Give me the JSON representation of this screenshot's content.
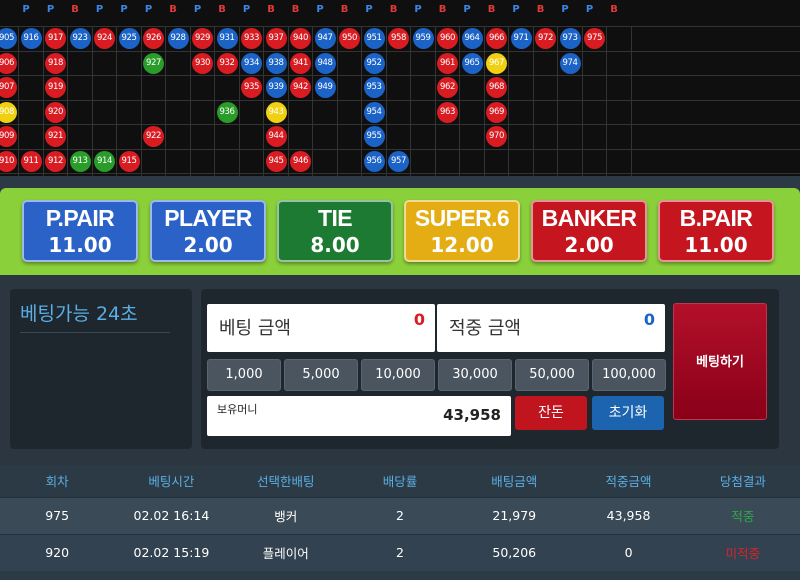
{
  "colors": {
    "player": "#1c63c8",
    "banker": "#d81c22",
    "tie": "#2a9c2a",
    "super6": "#f0d010"
  },
  "road": {
    "header": [
      "P",
      "P",
      "B",
      "P",
      "P",
      "P",
      "B",
      "P",
      "B",
      "P",
      "B",
      "B",
      "P",
      "B",
      "P",
      "B",
      "P",
      "B",
      "P",
      "B",
      "P",
      "B",
      "P",
      "P",
      "B"
    ],
    "header_first_index": 0,
    "columns": [
      {
        "beads": [
          [
            "905",
            "P"
          ],
          [
            "906",
            "B"
          ],
          [
            "907",
            "B"
          ],
          [
            "908",
            "S"
          ],
          [
            "909",
            "B"
          ],
          [
            "910",
            "B"
          ]
        ]
      },
      {
        "beads": [
          [
            "916",
            "P"
          ],
          null,
          null,
          null,
          null,
          [
            "911",
            "B"
          ]
        ]
      },
      {
        "beads": [
          [
            "917",
            "B"
          ],
          [
            "918",
            "B"
          ],
          [
            "919",
            "B"
          ],
          [
            "920",
            "B"
          ],
          [
            "921",
            "B"
          ],
          [
            "912",
            "B"
          ]
        ]
      },
      {
        "beads": [
          [
            "923",
            "P"
          ],
          null,
          null,
          null,
          null,
          [
            "913",
            "T"
          ]
        ]
      },
      {
        "beads": [
          [
            "924",
            "B"
          ],
          null,
          null,
          null,
          null,
          [
            "914",
            "T"
          ]
        ]
      },
      {
        "beads": [
          [
            "925",
            "P"
          ],
          null,
          null,
          null,
          null,
          [
            "915",
            "B"
          ]
        ]
      },
      {
        "beads": [
          [
            "926",
            "B"
          ],
          [
            "927",
            "T"
          ],
          null,
          null,
          [
            "922",
            "B"
          ],
          null
        ]
      },
      {
        "beads": [
          [
            "928",
            "P"
          ],
          null,
          null,
          null,
          null,
          null
        ]
      },
      {
        "beads": [
          [
            "929",
            "B"
          ],
          [
            "930",
            "B"
          ],
          null,
          null,
          null,
          null
        ]
      },
      {
        "beads": [
          [
            "931",
            "P"
          ],
          [
            "932",
            "B"
          ],
          null,
          [
            "936",
            "T"
          ],
          null,
          null
        ]
      },
      {
        "beads": [
          [
            "933",
            "B"
          ],
          [
            "934",
            "P"
          ],
          [
            "935",
            "B"
          ],
          null,
          null,
          null
        ]
      },
      {
        "beads": [
          [
            "937",
            "B"
          ],
          [
            "938",
            "P"
          ],
          [
            "939",
            "P"
          ],
          [
            "943",
            "S"
          ],
          [
            "944",
            "B"
          ],
          [
            "945",
            "B"
          ]
        ]
      },
      {
        "beads": [
          [
            "940",
            "B"
          ],
          [
            "941",
            "B"
          ],
          [
            "942",
            "B"
          ],
          null,
          null,
          [
            "946",
            "B"
          ]
        ]
      },
      {
        "beads": [
          [
            "947",
            "P"
          ],
          [
            "948",
            "P"
          ],
          [
            "949",
            "P"
          ],
          null,
          null,
          null
        ]
      },
      {
        "beads": [
          [
            "950",
            "B"
          ],
          null,
          null,
          null,
          null,
          null
        ]
      },
      {
        "beads": [
          [
            "951",
            "P"
          ],
          [
            "952",
            "P"
          ],
          [
            "953",
            "P"
          ],
          [
            "954",
            "P"
          ],
          [
            "955",
            "P"
          ],
          [
            "956",
            "P"
          ]
        ]
      },
      {
        "beads": [
          [
            "958",
            "B"
          ],
          null,
          null,
          null,
          null,
          [
            "957",
            "P"
          ]
        ]
      },
      {
        "beads": [
          [
            "959",
            "P"
          ],
          null,
          null,
          null,
          null,
          null
        ]
      },
      {
        "beads": [
          [
            "960",
            "B"
          ],
          [
            "961",
            "B"
          ],
          [
            "962",
            "B"
          ],
          [
            "963",
            "B"
          ],
          null,
          null
        ]
      },
      {
        "beads": [
          [
            "964",
            "P"
          ],
          [
            "965",
            "P"
          ],
          null,
          null,
          null,
          null
        ]
      },
      {
        "beads": [
          [
            "966",
            "B"
          ],
          [
            "967",
            "S"
          ],
          [
            "968",
            "B"
          ],
          [
            "969",
            "B"
          ],
          [
            "970",
            "B"
          ],
          null
        ]
      },
      {
        "beads": [
          [
            "971",
            "P"
          ],
          null,
          null,
          null,
          null,
          null
        ]
      },
      {
        "beads": [
          [
            "972",
            "B"
          ],
          null,
          null,
          null,
          null,
          null
        ]
      },
      {
        "beads": [
          [
            "973",
            "P"
          ],
          [
            "974",
            "P"
          ],
          null,
          null,
          null,
          null
        ]
      },
      {
        "beads": [
          [
            "975",
            "B"
          ],
          null,
          null,
          null,
          null,
          null
        ]
      }
    ]
  },
  "odds": [
    {
      "name": "P.PAIR",
      "value": "11.00",
      "color": "#2b62c8"
    },
    {
      "name": "PLAYER",
      "value": "2.00",
      "color": "#2b62c8"
    },
    {
      "name": "TIE",
      "value": "8.00",
      "color": "#1c7a32"
    },
    {
      "name": "SUPER.6",
      "value": "12.00",
      "color": "#e3ad13"
    },
    {
      "name": "BANKER",
      "value": "2.00",
      "color": "#c5151e"
    },
    {
      "name": "B.PAIR",
      "value": "11.00",
      "color": "#c5151e"
    }
  ],
  "panel": {
    "timer_label": "베팅가능 24초",
    "bet_amount_label": "베팅 금액",
    "bet_amount_value": "0",
    "win_amount_label": "적중 금액",
    "win_amount_value": "0",
    "chips": [
      "1,000",
      "5,000",
      "10,000",
      "30,000",
      "50,000",
      "100,000"
    ],
    "money_label": "보유머니",
    "money_value": "43,958",
    "change_label": "잔돈",
    "reset_label": "초기화",
    "submit_label": "베팅하기"
  },
  "history": {
    "headers": [
      "회차",
      "베팅시간",
      "선택한배팅",
      "배당률",
      "배팅금액",
      "적중금액",
      "당첨결과"
    ],
    "rows": [
      {
        "round": "975",
        "time": "02.02 16:14",
        "choice": "뱅커",
        "rate": "2",
        "bet": "21,979",
        "win": "43,958",
        "result": "적중",
        "result_color": "#2ea84a"
      },
      {
        "round": "920",
        "time": "02.02 15:19",
        "choice": "플레이어",
        "rate": "2",
        "bet": "50,206",
        "win": "0",
        "result": "미적중",
        "result_color": "#d8232a"
      }
    ]
  }
}
